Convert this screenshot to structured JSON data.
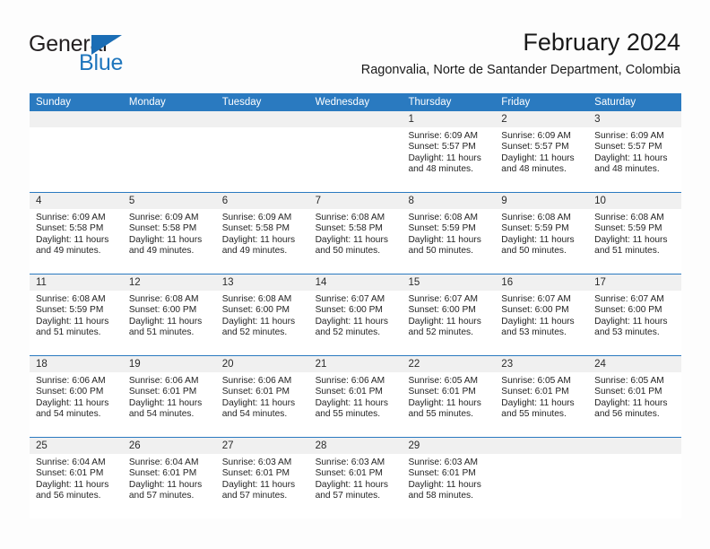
{
  "logo": {
    "text_primary": "General",
    "text_secondary": "Blue",
    "flag_icon": "triangle-flag-icon",
    "colors": {
      "primary": "#231f20",
      "secondary": "#1f76bd",
      "flag": "#1a6db5"
    }
  },
  "header": {
    "title": "February 2024",
    "subtitle": "Ragonvalia, Norte de Santander Department, Colombia"
  },
  "theme": {
    "header_bar": "#2a7ac0",
    "daynum_band": "#f0f0f0",
    "separator": "#2a7ac0",
    "text": "#242424",
    "page_background": "#fdfdfd"
  },
  "calendar": {
    "weekdays": [
      "Sunday",
      "Monday",
      "Tuesday",
      "Wednesday",
      "Thursday",
      "Friday",
      "Saturday"
    ],
    "weeks": [
      [
        {
          "day": "",
          "lines": []
        },
        {
          "day": "",
          "lines": []
        },
        {
          "day": "",
          "lines": []
        },
        {
          "day": "",
          "lines": []
        },
        {
          "day": "1",
          "lines": [
            "Sunrise: 6:09 AM",
            "Sunset: 5:57 PM",
            "Daylight: 11 hours",
            "and 48 minutes."
          ]
        },
        {
          "day": "2",
          "lines": [
            "Sunrise: 6:09 AM",
            "Sunset: 5:57 PM",
            "Daylight: 11 hours",
            "and 48 minutes."
          ]
        },
        {
          "day": "3",
          "lines": [
            "Sunrise: 6:09 AM",
            "Sunset: 5:57 PM",
            "Daylight: 11 hours",
            "and 48 minutes."
          ]
        }
      ],
      [
        {
          "day": "4",
          "lines": [
            "Sunrise: 6:09 AM",
            "Sunset: 5:58 PM",
            "Daylight: 11 hours",
            "and 49 minutes."
          ]
        },
        {
          "day": "5",
          "lines": [
            "Sunrise: 6:09 AM",
            "Sunset: 5:58 PM",
            "Daylight: 11 hours",
            "and 49 minutes."
          ]
        },
        {
          "day": "6",
          "lines": [
            "Sunrise: 6:09 AM",
            "Sunset: 5:58 PM",
            "Daylight: 11 hours",
            "and 49 minutes."
          ]
        },
        {
          "day": "7",
          "lines": [
            "Sunrise: 6:08 AM",
            "Sunset: 5:58 PM",
            "Daylight: 11 hours",
            "and 50 minutes."
          ]
        },
        {
          "day": "8",
          "lines": [
            "Sunrise: 6:08 AM",
            "Sunset: 5:59 PM",
            "Daylight: 11 hours",
            "and 50 minutes."
          ]
        },
        {
          "day": "9",
          "lines": [
            "Sunrise: 6:08 AM",
            "Sunset: 5:59 PM",
            "Daylight: 11 hours",
            "and 50 minutes."
          ]
        },
        {
          "day": "10",
          "lines": [
            "Sunrise: 6:08 AM",
            "Sunset: 5:59 PM",
            "Daylight: 11 hours",
            "and 51 minutes."
          ]
        }
      ],
      [
        {
          "day": "11",
          "lines": [
            "Sunrise: 6:08 AM",
            "Sunset: 5:59 PM",
            "Daylight: 11 hours",
            "and 51 minutes."
          ]
        },
        {
          "day": "12",
          "lines": [
            "Sunrise: 6:08 AM",
            "Sunset: 6:00 PM",
            "Daylight: 11 hours",
            "and 51 minutes."
          ]
        },
        {
          "day": "13",
          "lines": [
            "Sunrise: 6:08 AM",
            "Sunset: 6:00 PM",
            "Daylight: 11 hours",
            "and 52 minutes."
          ]
        },
        {
          "day": "14",
          "lines": [
            "Sunrise: 6:07 AM",
            "Sunset: 6:00 PM",
            "Daylight: 11 hours",
            "and 52 minutes."
          ]
        },
        {
          "day": "15",
          "lines": [
            "Sunrise: 6:07 AM",
            "Sunset: 6:00 PM",
            "Daylight: 11 hours",
            "and 52 minutes."
          ]
        },
        {
          "day": "16",
          "lines": [
            "Sunrise: 6:07 AM",
            "Sunset: 6:00 PM",
            "Daylight: 11 hours",
            "and 53 minutes."
          ]
        },
        {
          "day": "17",
          "lines": [
            "Sunrise: 6:07 AM",
            "Sunset: 6:00 PM",
            "Daylight: 11 hours",
            "and 53 minutes."
          ]
        }
      ],
      [
        {
          "day": "18",
          "lines": [
            "Sunrise: 6:06 AM",
            "Sunset: 6:00 PM",
            "Daylight: 11 hours",
            "and 54 minutes."
          ]
        },
        {
          "day": "19",
          "lines": [
            "Sunrise: 6:06 AM",
            "Sunset: 6:01 PM",
            "Daylight: 11 hours",
            "and 54 minutes."
          ]
        },
        {
          "day": "20",
          "lines": [
            "Sunrise: 6:06 AM",
            "Sunset: 6:01 PM",
            "Daylight: 11 hours",
            "and 54 minutes."
          ]
        },
        {
          "day": "21",
          "lines": [
            "Sunrise: 6:06 AM",
            "Sunset: 6:01 PM",
            "Daylight: 11 hours",
            "and 55 minutes."
          ]
        },
        {
          "day": "22",
          "lines": [
            "Sunrise: 6:05 AM",
            "Sunset: 6:01 PM",
            "Daylight: 11 hours",
            "and 55 minutes."
          ]
        },
        {
          "day": "23",
          "lines": [
            "Sunrise: 6:05 AM",
            "Sunset: 6:01 PM",
            "Daylight: 11 hours",
            "and 55 minutes."
          ]
        },
        {
          "day": "24",
          "lines": [
            "Sunrise: 6:05 AM",
            "Sunset: 6:01 PM",
            "Daylight: 11 hours",
            "and 56 minutes."
          ]
        }
      ],
      [
        {
          "day": "25",
          "lines": [
            "Sunrise: 6:04 AM",
            "Sunset: 6:01 PM",
            "Daylight: 11 hours",
            "and 56 minutes."
          ]
        },
        {
          "day": "26",
          "lines": [
            "Sunrise: 6:04 AM",
            "Sunset: 6:01 PM",
            "Daylight: 11 hours",
            "and 57 minutes."
          ]
        },
        {
          "day": "27",
          "lines": [
            "Sunrise: 6:03 AM",
            "Sunset: 6:01 PM",
            "Daylight: 11 hours",
            "and 57 minutes."
          ]
        },
        {
          "day": "28",
          "lines": [
            "Sunrise: 6:03 AM",
            "Sunset: 6:01 PM",
            "Daylight: 11 hours",
            "and 57 minutes."
          ]
        },
        {
          "day": "29",
          "lines": [
            "Sunrise: 6:03 AM",
            "Sunset: 6:01 PM",
            "Daylight: 11 hours",
            "and 58 minutes."
          ]
        },
        {
          "day": "",
          "lines": []
        },
        {
          "day": "",
          "lines": []
        }
      ]
    ]
  }
}
